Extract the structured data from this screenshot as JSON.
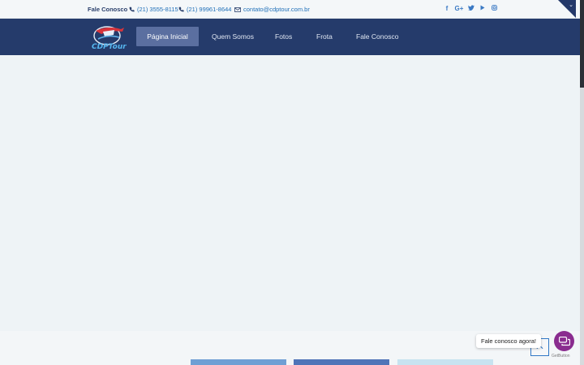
{
  "topbar": {
    "contact_label": "Fale Conosco",
    "phone1": "(21) 3555-8115",
    "phone2": "(21) 99961-8644",
    "email": "contato@cdptour.com.br",
    "socials": [
      "facebook-icon",
      "google-plus-icon",
      "twitter-icon",
      "youtube-icon",
      "instagram-icon"
    ]
  },
  "nav": {
    "items": [
      {
        "label": "Página Inicial",
        "active": true
      },
      {
        "label": "Quem Somos",
        "active": false
      },
      {
        "label": "Fotos",
        "active": false
      },
      {
        "label": "Frota",
        "active": false
      },
      {
        "label": "Fale Conosco",
        "active": false
      }
    ],
    "logo_text": "CDPTour"
  },
  "widget": {
    "tooltip": "Fale conosco agora!",
    "brand": "GetButton"
  },
  "colors": {
    "nav_bg": "#253b6b",
    "active_bg": "#5b6fa0",
    "link": "#1f6fb8",
    "chat": "#8a2c8f"
  }
}
